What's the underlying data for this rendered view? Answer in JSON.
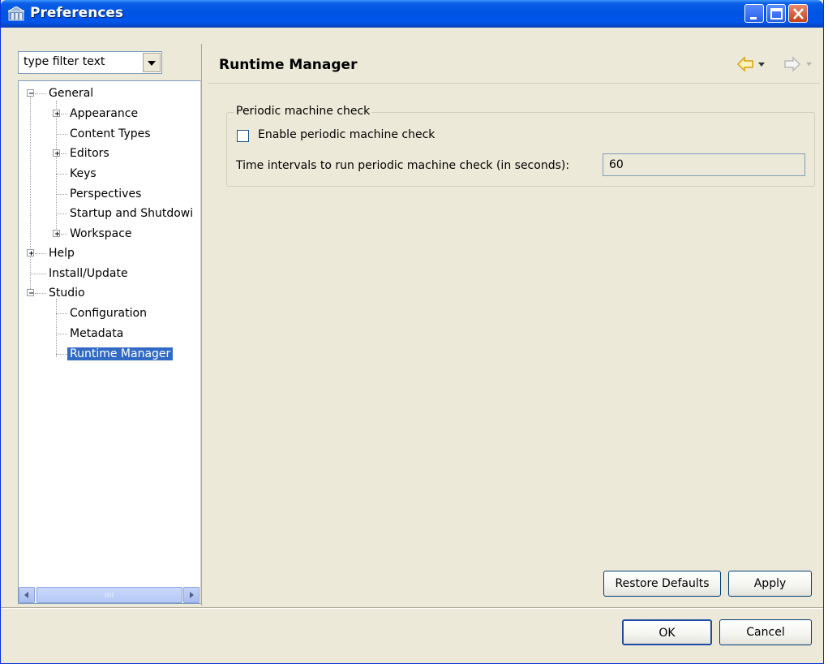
{
  "window": {
    "title": "Preferences"
  },
  "filter": {
    "value": "type filter text"
  },
  "tree": {
    "general": "General",
    "appearance": "Appearance",
    "content_types": "Content Types",
    "editors": "Editors",
    "keys": "Keys",
    "perspectives": "Perspectives",
    "startup": "Startup and Shutdowi",
    "workspace": "Workspace",
    "help": "Help",
    "install_update": "Install/Update",
    "studio": "Studio",
    "configuration": "Configuration",
    "metadata": "Metadata",
    "runtime_manager": "Runtime Manager"
  },
  "page": {
    "title": "Runtime Manager",
    "group_label": "Periodic machine check",
    "checkbox_label": "Enable periodic machine check",
    "checkbox_checked": false,
    "interval_label": "Time intervals to run periodic machine check (in seconds):",
    "interval_value": "60"
  },
  "buttons": {
    "restore_defaults": "Restore Defaults",
    "apply": "Apply",
    "ok": "OK",
    "cancel": "Cancel"
  },
  "colors": {
    "titlebar": "#0054e3",
    "selection": "#316ac5",
    "panel_bg": "#ece9d8",
    "nav_arrow": "#e8b020"
  }
}
